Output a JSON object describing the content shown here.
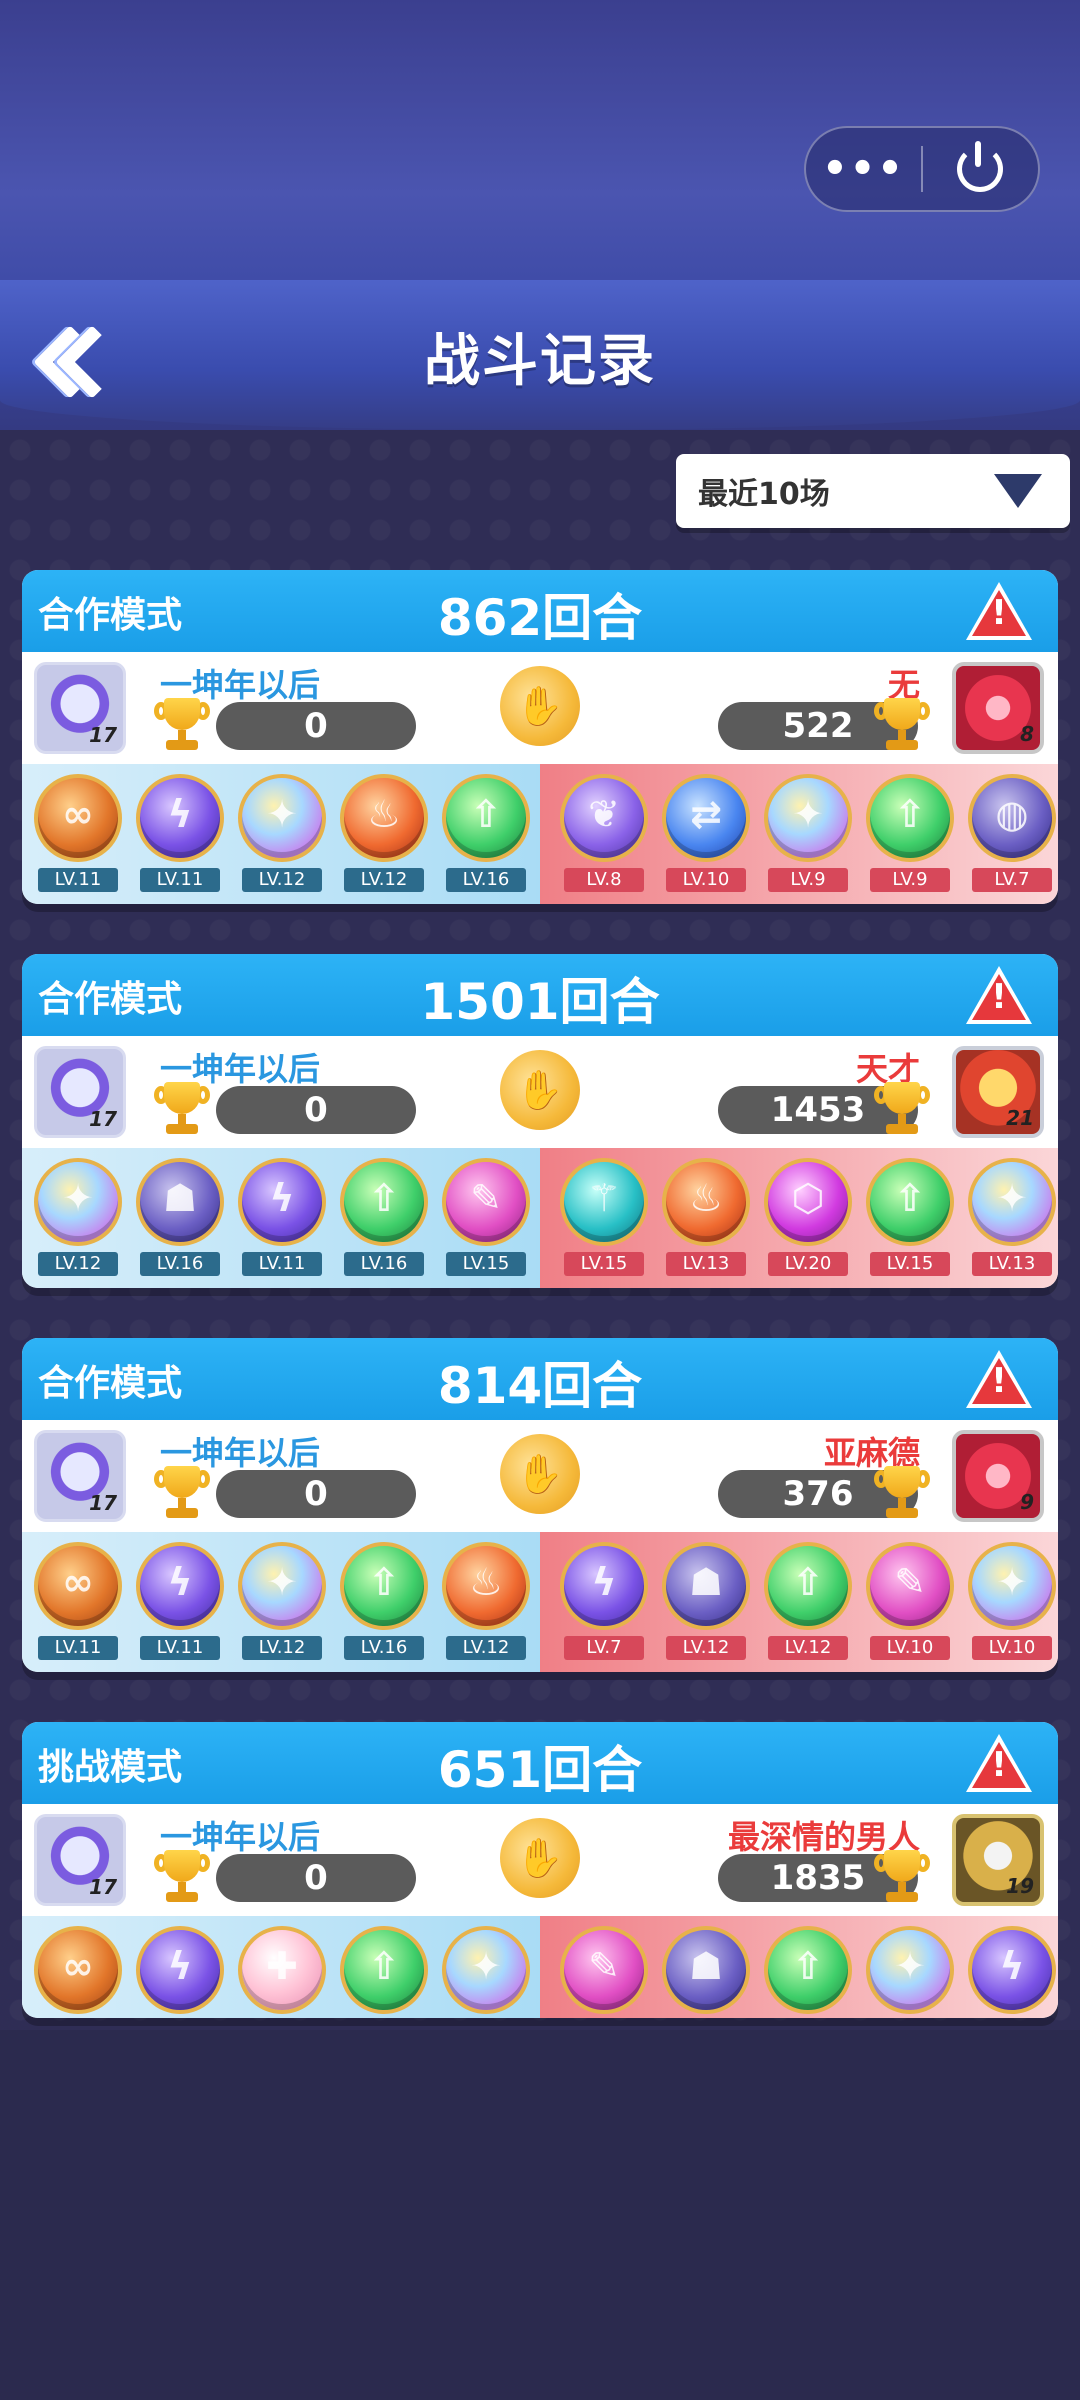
{
  "header": {
    "title": "战斗记录",
    "menu_icon": "more-dots-icon",
    "power_icon": "power-icon",
    "more_dots": "•••"
  },
  "filter": {
    "selected": "最近10场"
  },
  "records": [
    {
      "mode": "合作模式",
      "rounds": "862回合",
      "me": {
        "name": "一坤年以后",
        "score": "0",
        "level": "17"
      },
      "opp": {
        "name": "无",
        "score": "522",
        "level": "8",
        "avatar": "fire"
      },
      "my_team": [
        {
          "lv": "LV.11",
          "color": "orange",
          "glyph": "∞"
        },
        {
          "lv": "LV.11",
          "color": "purple",
          "glyph": "ϟ"
        },
        {
          "lv": "LV.12",
          "color": "rainbow",
          "glyph": "✦"
        },
        {
          "lv": "LV.12",
          "color": "fire",
          "glyph": "♨"
        },
        {
          "lv": "LV.16",
          "color": "green",
          "glyph": "⇧"
        }
      ],
      "opp_team": [
        {
          "lv": "LV.8",
          "color": "violet",
          "glyph": "❦"
        },
        {
          "lv": "LV.10",
          "color": "blue",
          "glyph": "⇄"
        },
        {
          "lv": "LV.9",
          "color": "rainbow",
          "glyph": "✦"
        },
        {
          "lv": "LV.9",
          "color": "green",
          "glyph": "⇧"
        },
        {
          "lv": "LV.7",
          "color": "dark",
          "glyph": "◍"
        }
      ]
    },
    {
      "mode": "合作模式",
      "rounds": "1501回合",
      "me": {
        "name": "一坤年以后",
        "score": "0",
        "level": "17"
      },
      "opp": {
        "name": "天才",
        "score": "1453",
        "level": "21",
        "avatar": "robot"
      },
      "my_team": [
        {
          "lv": "LV.12",
          "color": "rainbow",
          "glyph": "✦"
        },
        {
          "lv": "LV.16",
          "color": "dark",
          "glyph": "☗"
        },
        {
          "lv": "LV.11",
          "color": "purple",
          "glyph": "ϟ"
        },
        {
          "lv": "LV.16",
          "color": "green",
          "glyph": "⇧"
        },
        {
          "lv": "LV.15",
          "color": "pink",
          "glyph": "✎"
        }
      ],
      "opp_team": [
        {
          "lv": "LV.15",
          "color": "teal",
          "glyph": "⚚"
        },
        {
          "lv": "LV.13",
          "color": "fire",
          "glyph": "♨"
        },
        {
          "lv": "LV.20",
          "color": "magenta",
          "glyph": "⬡"
        },
        {
          "lv": "LV.15",
          "color": "green",
          "glyph": "⇧"
        },
        {
          "lv": "LV.13",
          "color": "rainbow",
          "glyph": "✦"
        }
      ]
    },
    {
      "mode": "合作模式",
      "rounds": "814回合",
      "me": {
        "name": "一坤年以后",
        "score": "0",
        "level": "17"
      },
      "opp": {
        "name": "亚麻德",
        "score": "376",
        "level": "9",
        "avatar": "fire"
      },
      "my_team": [
        {
          "lv": "LV.11",
          "color": "orange",
          "glyph": "∞"
        },
        {
          "lv": "LV.11",
          "color": "purple",
          "glyph": "ϟ"
        },
        {
          "lv": "LV.12",
          "color": "rainbow",
          "glyph": "✦"
        },
        {
          "lv": "LV.16",
          "color": "green",
          "glyph": "⇧"
        },
        {
          "lv": "LV.12",
          "color": "fire",
          "glyph": "♨"
        }
      ],
      "opp_team": [
        {
          "lv": "LV.7",
          "color": "purple",
          "glyph": "ϟ"
        },
        {
          "lv": "LV.12",
          "color": "dark",
          "glyph": "☗"
        },
        {
          "lv": "LV.12",
          "color": "green",
          "glyph": "⇧"
        },
        {
          "lv": "LV.10",
          "color": "pink",
          "glyph": "✎"
        },
        {
          "lv": "LV.10",
          "color": "rainbow",
          "glyph": "✦"
        }
      ]
    },
    {
      "mode": "挑战模式",
      "rounds": "651回合",
      "me": {
        "name": "一坤年以后",
        "score": "0",
        "level": "17"
      },
      "opp": {
        "name": "最深情的男人",
        "score": "1835",
        "level": "19",
        "avatar": "knight"
      },
      "my_team": [
        {
          "lv": "",
          "color": "orange",
          "glyph": "∞"
        },
        {
          "lv": "",
          "color": "purple",
          "glyph": "ϟ"
        },
        {
          "lv": "",
          "color": "angel",
          "glyph": "✚"
        },
        {
          "lv": "",
          "color": "green",
          "glyph": "⇧"
        },
        {
          "lv": "",
          "color": "rainbow",
          "glyph": "✦"
        }
      ],
      "opp_team": [
        {
          "lv": "",
          "color": "pink",
          "glyph": "✎"
        },
        {
          "lv": "",
          "color": "dark",
          "glyph": "☗"
        },
        {
          "lv": "",
          "color": "green",
          "glyph": "⇧"
        },
        {
          "lv": "",
          "color": "rainbow",
          "glyph": "✦"
        },
        {
          "lv": "",
          "color": "purple",
          "glyph": "ϟ"
        }
      ]
    }
  ]
}
